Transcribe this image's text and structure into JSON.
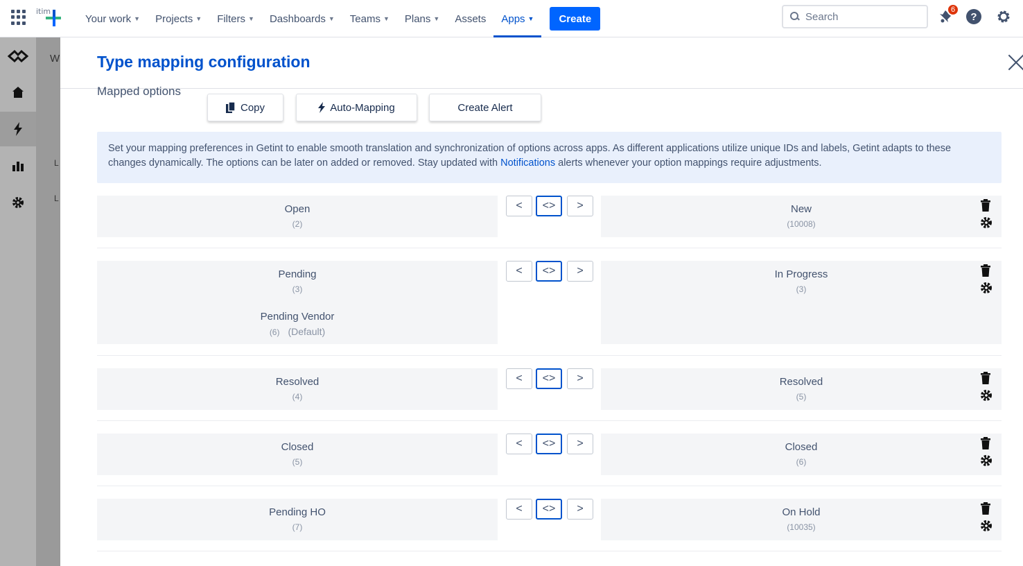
{
  "topnav": {
    "logo_text": "itim",
    "items": [
      {
        "label": "Your work"
      },
      {
        "label": "Projects"
      },
      {
        "label": "Filters"
      },
      {
        "label": "Dashboards"
      },
      {
        "label": "Teams"
      },
      {
        "label": "Plans"
      },
      {
        "label": "Assets"
      },
      {
        "label": "Apps"
      }
    ],
    "create_label": "Create",
    "search_placeholder": "Search",
    "notification_count": "6"
  },
  "side_panel": {
    "fragments": [
      "W",
      "L",
      "L"
    ]
  },
  "modal": {
    "title": "Type mapping configuration",
    "mapped_options_label": "Mapped options",
    "buttons": {
      "copy": "Copy",
      "auto_mapping": "Auto-Mapping",
      "create_alert": "Create Alert"
    },
    "info": {
      "text_before": "Set your mapping preferences in Getint to enable smooth translation and synchronization of options across apps. As different applications utilize unique IDs and labels, Getint adapts to these changes dynamically. The options can be later on added or removed. Stay updated with ",
      "link": "Notifications",
      "text_after": " alerts whenever your option mappings require adjustments."
    },
    "rows": [
      {
        "left": [
          {
            "name": "Open",
            "id": "(2)"
          }
        ],
        "right": [
          {
            "name": "New",
            "id": "(10008)"
          }
        ]
      },
      {
        "left": [
          {
            "name": "Pending",
            "id": "(3)"
          },
          {
            "name": "Pending Vendor",
            "id": "(6)",
            "default": "(Default)"
          }
        ],
        "right": [
          {
            "name": "In Progress",
            "id": "(3)"
          }
        ]
      },
      {
        "left": [
          {
            "name": "Resolved",
            "id": "(4)"
          }
        ],
        "right": [
          {
            "name": "Resolved",
            "id": "(5)"
          }
        ]
      },
      {
        "left": [
          {
            "name": "Closed",
            "id": "(5)"
          }
        ],
        "right": [
          {
            "name": "Closed",
            "id": "(6)"
          }
        ]
      },
      {
        "left": [
          {
            "name": "Pending HO",
            "id": "(7)"
          }
        ],
        "right": [
          {
            "name": "On Hold",
            "id": "(10035)"
          }
        ]
      }
    ],
    "arrows": {
      "left": "<",
      "both": "<>",
      "right": ">"
    }
  }
}
